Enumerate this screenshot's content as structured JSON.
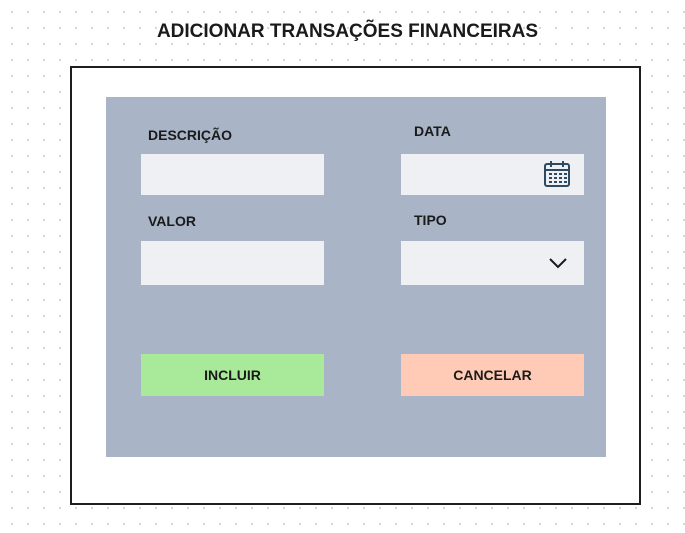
{
  "page": {
    "title": "ADICIONAR TRANSAÇÕES FINANCEIRAS"
  },
  "form": {
    "descricao": {
      "label": "DESCRIÇÃO",
      "value": ""
    },
    "data": {
      "label": "DATA",
      "value": "",
      "icon": "calendar-icon"
    },
    "valor": {
      "label": "VALOR",
      "value": ""
    },
    "tipo": {
      "label": "TIPO",
      "value": "",
      "icon": "chevron-down-icon"
    }
  },
  "actions": {
    "incluir": {
      "label": "INCLUIR",
      "color": "#a9e99a"
    },
    "cancelar": {
      "label": "CANCELAR",
      "color": "#ffcbb6"
    }
  },
  "colors": {
    "panel": "#a9b5c6",
    "field": "#eff0f4",
    "frame_border": "#1e1e1e",
    "icon": "#2f4a60"
  }
}
